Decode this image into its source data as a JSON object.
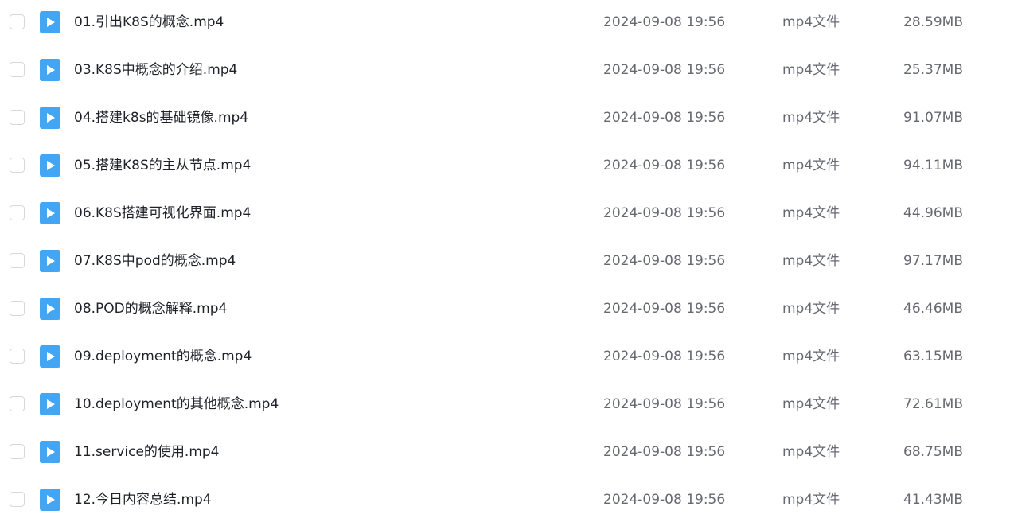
{
  "colors": {
    "icon_blue": "#43a6f4",
    "text_primary": "#1f2329",
    "text_secondary": "#666a70",
    "checkbox_border": "#d5d8de"
  },
  "files": [
    {
      "name": "01.引出K8S的概念.mp4",
      "date": "2024-09-08 19:56",
      "type": "mp4文件",
      "size": "28.59MB",
      "icon": "video-file-icon",
      "checked": false
    },
    {
      "name": "03.K8S中概念的介绍.mp4",
      "date": "2024-09-08 19:56",
      "type": "mp4文件",
      "size": "25.37MB",
      "icon": "video-file-icon",
      "checked": false
    },
    {
      "name": "04.搭建k8s的基础镜像.mp4",
      "date": "2024-09-08 19:56",
      "type": "mp4文件",
      "size": "91.07MB",
      "icon": "video-file-icon",
      "checked": false
    },
    {
      "name": "05.搭建K8S的主从节点.mp4",
      "date": "2024-09-08 19:56",
      "type": "mp4文件",
      "size": "94.11MB",
      "icon": "video-file-icon",
      "checked": false
    },
    {
      "name": "06.K8S搭建可视化界面.mp4",
      "date": "2024-09-08 19:56",
      "type": "mp4文件",
      "size": "44.96MB",
      "icon": "video-file-icon",
      "checked": false
    },
    {
      "name": "07.K8S中pod的概念.mp4",
      "date": "2024-09-08 19:56",
      "type": "mp4文件",
      "size": "97.17MB",
      "icon": "video-file-icon",
      "checked": false
    },
    {
      "name": "08.POD的概念解释.mp4",
      "date": "2024-09-08 19:56",
      "type": "mp4文件",
      "size": "46.46MB",
      "icon": "video-file-icon",
      "checked": false
    },
    {
      "name": "09.deployment的概念.mp4",
      "date": "2024-09-08 19:56",
      "type": "mp4文件",
      "size": "63.15MB",
      "icon": "video-file-icon",
      "checked": false
    },
    {
      "name": "10.deployment的其他概念.mp4",
      "date": "2024-09-08 19:56",
      "type": "mp4文件",
      "size": "72.61MB",
      "icon": "video-file-icon",
      "checked": false
    },
    {
      "name": "11.service的使用.mp4",
      "date": "2024-09-08 19:56",
      "type": "mp4文件",
      "size": "68.75MB",
      "icon": "video-file-icon",
      "checked": false
    },
    {
      "name": "12.今日内容总结.mp4",
      "date": "2024-09-08 19:56",
      "type": "mp4文件",
      "size": "41.43MB",
      "icon": "video-file-icon",
      "checked": false
    }
  ]
}
